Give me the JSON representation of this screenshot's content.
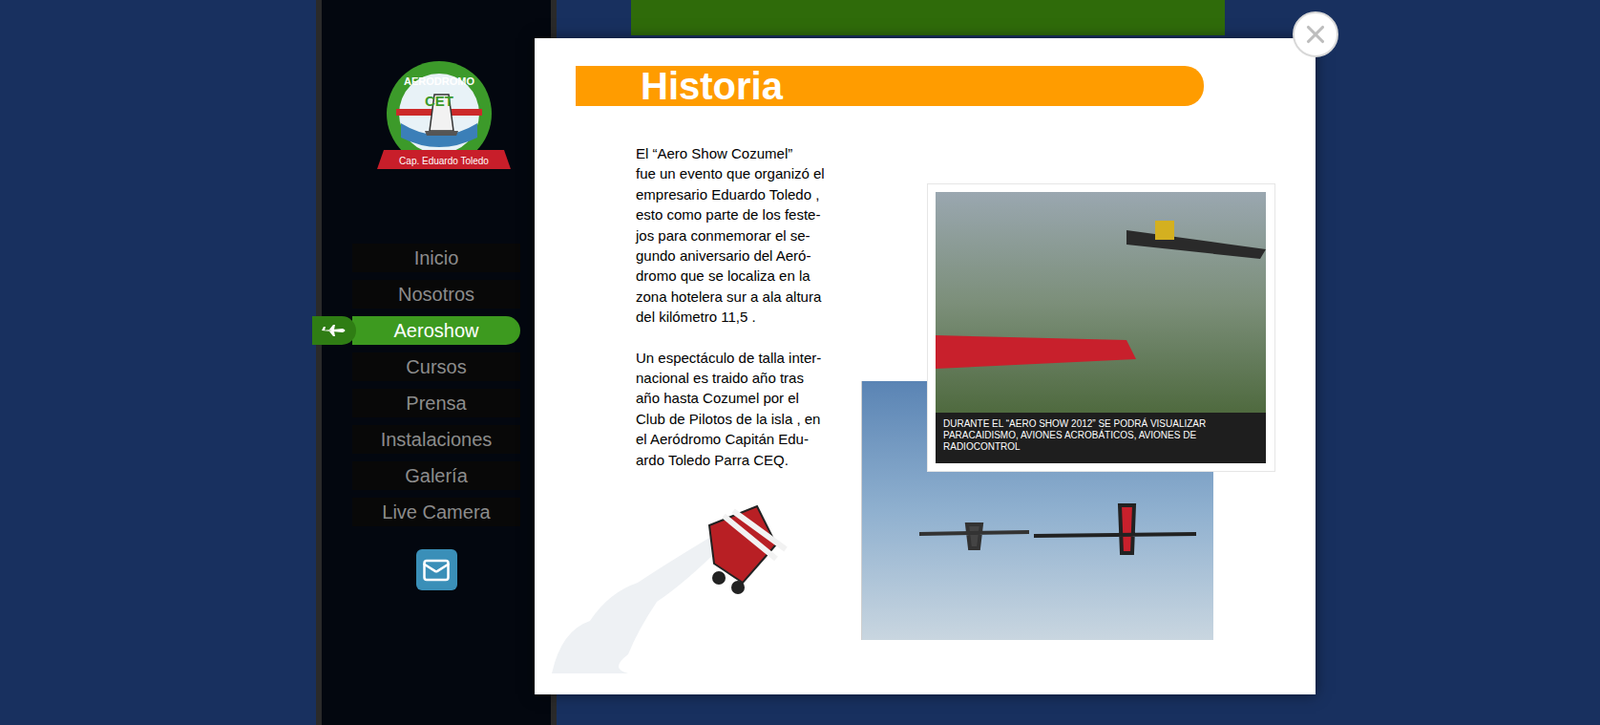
{
  "logo": {
    "top": "AERODROMO",
    "middle": "CET",
    "ribbon": "Cap. Eduardo Toledo"
  },
  "nav": [
    {
      "label": "Inicio",
      "selected": false
    },
    {
      "label": "Nosotros",
      "selected": false
    },
    {
      "label": "Aeroshow",
      "selected": true
    },
    {
      "label": "Cursos",
      "selected": false
    },
    {
      "label": "Prensa",
      "selected": false
    },
    {
      "label": "Instalaciones",
      "selected": false
    },
    {
      "label": "Galería",
      "selected": false
    },
    {
      "label": "Live Camera",
      "selected": false
    }
  ],
  "modal": {
    "title": "Historia",
    "paragraphs": [
      [
        "El “Aero Show Cozumel”",
        "fue un evento que organizó el",
        "empresario Eduardo Toledo ,",
        "esto como parte de los feste-",
        "jos para conmemorar el se-",
        "gundo aniversario del Aeró-",
        "dromo que se localiza en la",
        "zona hotelera sur a ala altura",
        "del kilómetro 11,5 ."
      ],
      [
        "Un espectáculo de talla inter-",
        "nacional es traido año tras",
        "año hasta Cozumel por el",
        "Club de Pilotos de la isla , en",
        "el Aeródromo Capitán Edu-",
        "ardo Toledo Parra CEQ."
      ]
    ],
    "caption": [
      "DURANTE EL “AERO SHOW 2012” SE PODRÁ VISUALIZAR",
      "PARACAIDISMO, AVIONES ACROBÁTICOS, AVIONES DE",
      "RADIOCONTROL"
    ]
  }
}
